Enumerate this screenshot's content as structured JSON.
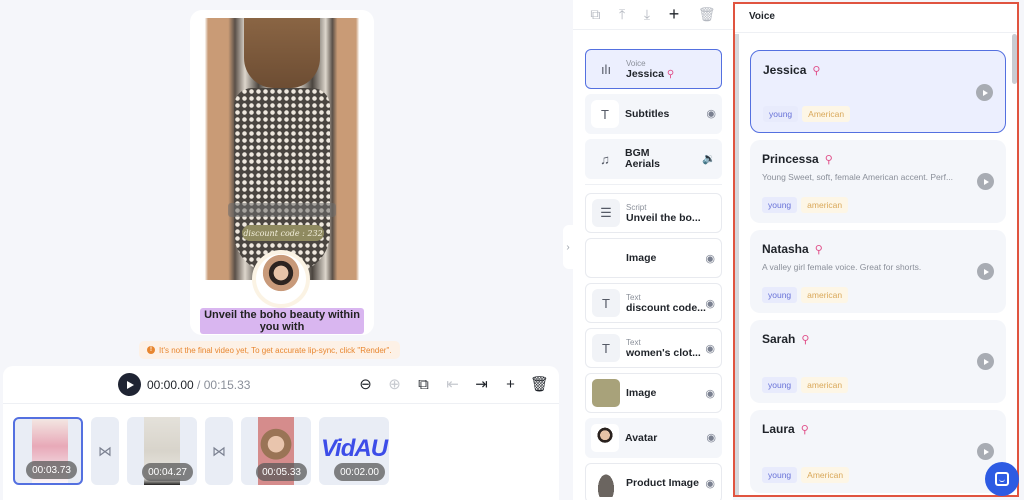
{
  "preview": {
    "discount_overlay": "discount code : 232",
    "subtitle_text": "Unveil the boho beauty within you with"
  },
  "warning": {
    "icon": "info-icon",
    "text": "It's not the final video yet, To get accurate lip-sync, click \"Render\"."
  },
  "timeline": {
    "current_time": "00:00.00",
    "separator": " / ",
    "total_time": "00:15.33",
    "tools": [
      {
        "icon": "zoom-out-icon",
        "glyph": "⊖",
        "enabled": true
      },
      {
        "icon": "zoom-in-icon",
        "glyph": "⊕",
        "enabled": false
      },
      {
        "icon": "duplicate-icon",
        "glyph": "⧉",
        "enabled": true
      },
      {
        "icon": "split-left-icon",
        "glyph": "⇤",
        "enabled": false
      },
      {
        "icon": "split-right-icon",
        "glyph": "⇥",
        "enabled": true
      },
      {
        "icon": "add-icon",
        "glyph": "+",
        "enabled": true
      },
      {
        "icon": "delete-icon",
        "glyph": "🗑",
        "enabled": true
      }
    ],
    "clips": [
      {
        "duration": "00:03.73",
        "selected": true
      },
      {
        "duration": "00:04.27",
        "selected": false
      },
      {
        "duration": "00:05.33",
        "selected": false
      },
      {
        "duration": "00:02.00",
        "selected": false,
        "logo": "VidAU"
      }
    ],
    "transition_glyph": "⋈"
  },
  "layers": {
    "toolbar": [
      {
        "icon": "copy-icon",
        "glyph": "⧉"
      },
      {
        "icon": "align-top-icon",
        "glyph": "⤒"
      },
      {
        "icon": "align-bottom-icon",
        "glyph": "⤓"
      },
      {
        "icon": "add-icon",
        "glyph": "+"
      },
      {
        "icon": "delete-icon",
        "glyph": "🗑"
      }
    ],
    "fixed": [
      {
        "kind": "Voice",
        "name": "Jessica",
        "female": "⚲"
      },
      {
        "kind": "",
        "name": "Subtitles",
        "glyph": "T"
      },
      {
        "kind": "BGM",
        "name": "Aerials",
        "glyph": "♫"
      }
    ],
    "items": [
      {
        "kind": "Script",
        "name": "Unveil the bo..."
      },
      {
        "kind": "",
        "name": "Image"
      },
      {
        "kind": "Text",
        "name": "discount code..."
      },
      {
        "kind": "Text",
        "name": "women's clot..."
      },
      {
        "kind": "",
        "name": "Image"
      },
      {
        "kind": "",
        "name": "Avatar"
      },
      {
        "kind": "",
        "name": "Product Image"
      }
    ],
    "image_swatch_color": "#a8a27a"
  },
  "voice_panel": {
    "title": "Voice",
    "voices": [
      {
        "name": "Jessica",
        "description": "",
        "tags": [
          "young",
          "American"
        ],
        "selected": true
      },
      {
        "name": "Princessa",
        "description": "Young Sweet, soft, female American accent. Perf...",
        "tags": [
          "young",
          "american"
        ],
        "selected": false
      },
      {
        "name": "Natasha",
        "description": "A valley girl female voice. Great for shorts.",
        "tags": [
          "young",
          "american"
        ],
        "selected": false
      },
      {
        "name": "Sarah",
        "description": "",
        "tags": [
          "young",
          "american"
        ],
        "selected": false
      },
      {
        "name": "Laura",
        "description": "",
        "tags": [
          "young",
          "American"
        ],
        "selected": false
      }
    ],
    "female_glyph": "⚲"
  },
  "colors": {
    "accent": "#5470e0",
    "highlight_border": "#e05440",
    "female_icon": "#e0508a",
    "warning": "#e8862f",
    "chat_fab": "#2d5be3"
  }
}
